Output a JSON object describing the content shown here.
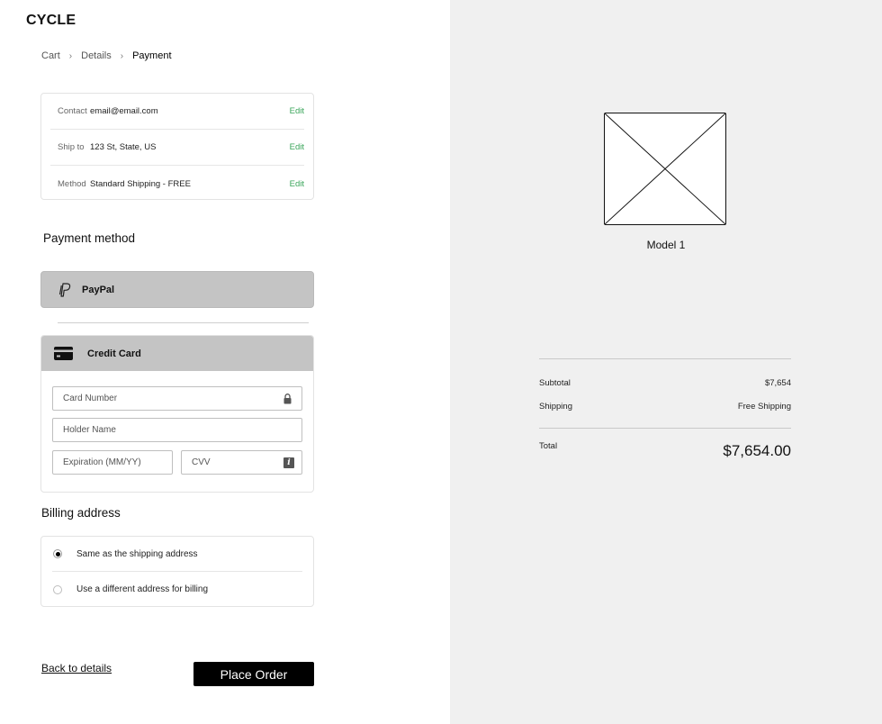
{
  "brand": {
    "logo": "CYCLE"
  },
  "breadcrumb": {
    "items": [
      "Cart",
      "Details",
      "Payment"
    ],
    "separator": "›"
  },
  "summary": {
    "rows": [
      {
        "key": "Contact",
        "value": "email@email.com",
        "action": "Edit"
      },
      {
        "key": "Ship to",
        "value": "123 St, State, US",
        "action": "Edit"
      },
      {
        "key": "Method",
        "value": "Standard Shipping - FREE",
        "action": "Edit"
      }
    ]
  },
  "payment": {
    "title": "Payment method",
    "paypal_label": "PayPal",
    "credit_card_label": "Credit Card",
    "fields": {
      "card_number_placeholder": "Card Number",
      "holder_name_placeholder": "Holder Name",
      "expiration_placeholder": "Expiration (MM/YY)",
      "cvv_placeholder": "CVV",
      "cvv_info_glyph": "i"
    }
  },
  "billing": {
    "title": "Billing address",
    "options": [
      {
        "label": "Same as the shipping address",
        "selected": true
      },
      {
        "label": "Use a different address for billing",
        "selected": false
      }
    ]
  },
  "actions": {
    "back_label": "Back to details",
    "place_order_label": "Place Order"
  },
  "order": {
    "product_name": "Model 1",
    "subtotal_label": "Subtotal",
    "subtotal_value": "$7,654",
    "shipping_label": "Shipping",
    "shipping_value": "Free Shipping",
    "total_label": "Total",
    "total_value": "$7,654.00"
  },
  "colors": {
    "accent_edit": "#3aa55a",
    "button_bg": "#000000",
    "panel_bg": "#f0f0f0",
    "method_bg": "#c4c4c4"
  },
  "icons": {
    "paypal": "paypal-icon",
    "credit_card": "credit-card-icon",
    "lock": "lock-icon",
    "info": "info-icon",
    "chevron": "chevron-right-icon",
    "image_placeholder": "image-placeholder-icon"
  }
}
